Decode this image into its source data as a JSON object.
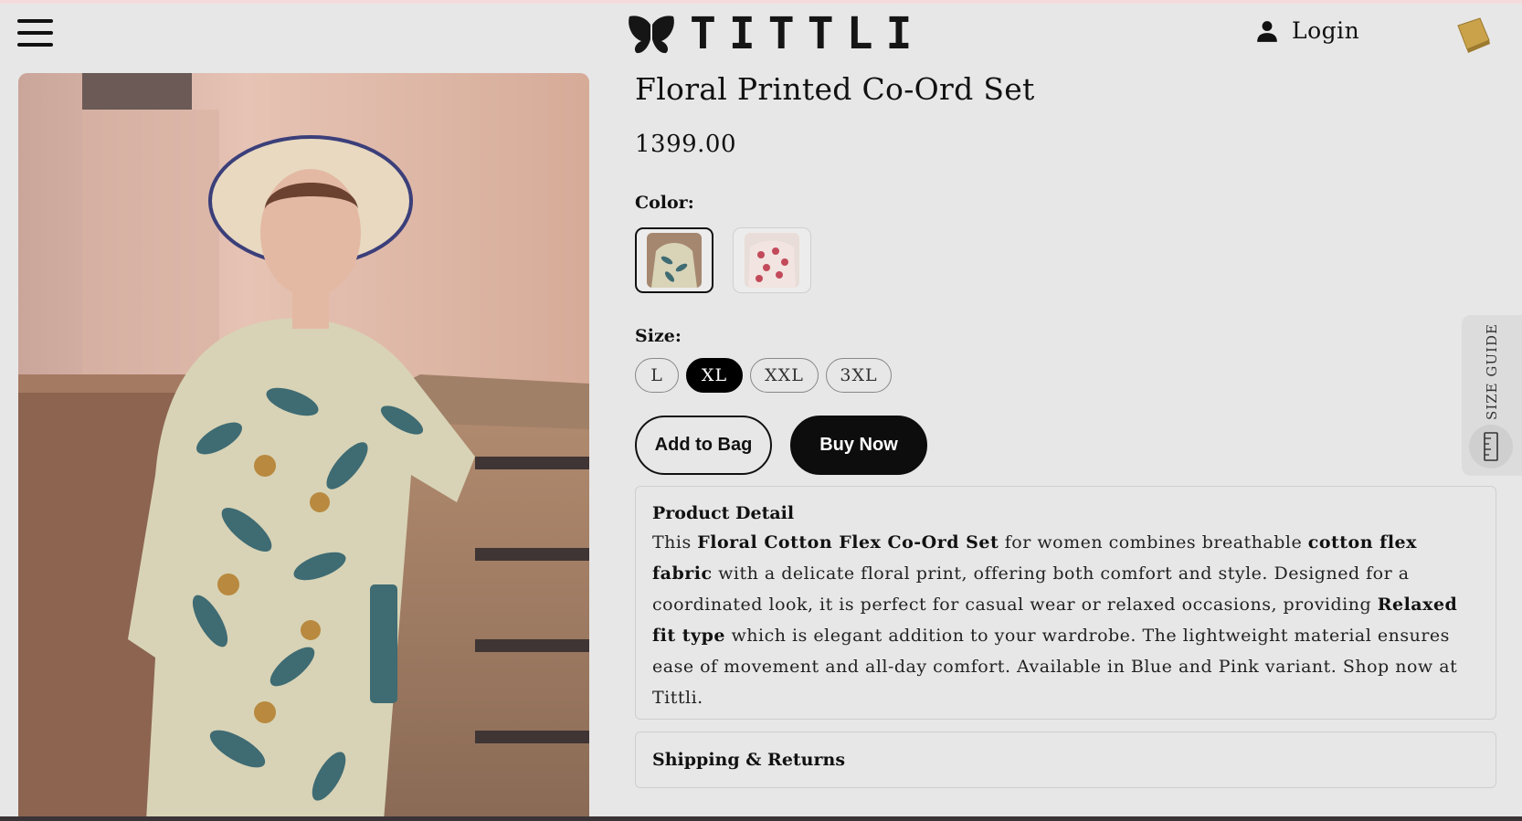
{
  "header": {
    "brand": "TITTLI",
    "login_label": "Login"
  },
  "product": {
    "title": "Floral Printed Co-Ord Set",
    "price": "1399.00",
    "color_label": "Color:",
    "colors": [
      {
        "name": "Blue",
        "selected": true
      },
      {
        "name": "Pink",
        "selected": false
      }
    ],
    "size_label": "Size:",
    "sizes": [
      {
        "label": "L",
        "selected": false
      },
      {
        "label": "XL",
        "selected": true
      },
      {
        "label": "XXL",
        "selected": false
      },
      {
        "label": "3XL",
        "selected": false
      }
    ],
    "add_to_bag_label": "Add to Bag",
    "buy_now_label": "Buy Now"
  },
  "detail": {
    "heading": "Product Detail",
    "p1": "This ",
    "b1": "Floral Cotton Flex Co-Ord Set",
    "p2": " for women combines breathable ",
    "b2": "cotton flex fabric",
    "p3": " with a delicate floral print, offering both comfort and style. Designed for a coordinated look, it is perfect for casual wear or relaxed occasions, providing ",
    "b3": "Relaxed fit type",
    "p4": " which is elegant addition to your wardrobe. The lightweight material ensures ease of movement and all-day comfort. Available in Blue and Pink variant.  Shop now at Tittli."
  },
  "shipping": {
    "label": "Shipping & Returns"
  },
  "size_guide": {
    "label": "SIZE GUIDE"
  },
  "icons": {
    "menu": "hamburger-menu-icon",
    "logo": "butterfly-logo-icon",
    "user": "user-icon",
    "bag": "shopping-bag-icon",
    "ruler": "ruler-icon"
  },
  "colors_theme": {
    "background": "#e8e7e7",
    "primary": "#0d0d0d",
    "border": "#cfcfcf"
  }
}
